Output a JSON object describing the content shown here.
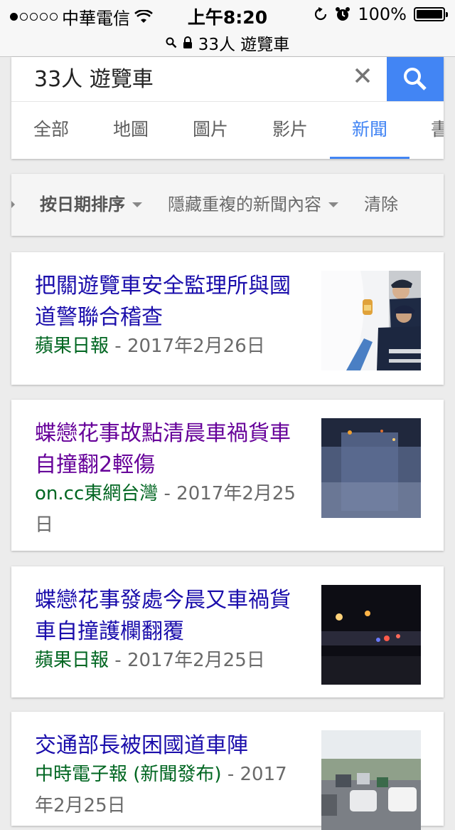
{
  "status_bar": {
    "carrier": "中華電信",
    "time": "上午8:20",
    "battery": "100%"
  },
  "url_bar": {
    "text": "33人 遊覽車"
  },
  "search": {
    "query": "33人 遊覽車",
    "accent_color": "#4285f4",
    "tabs": [
      {
        "label": "全部",
        "active": false
      },
      {
        "label": "地圖",
        "active": false
      },
      {
        "label": "圖片",
        "active": false
      },
      {
        "label": "影片",
        "active": false
      },
      {
        "label": "新聞",
        "active": true
      },
      {
        "label": "書",
        "active": false
      }
    ]
  },
  "filters": {
    "sort": "按日期排序",
    "dedupe": "隱藏重複的新聞內容",
    "clear": "清除"
  },
  "results": [
    {
      "title": "把關遊覽車安全監理所與國道警聯合稽查",
      "source": "蘋果日報",
      "separator": " - ",
      "date": "2017年2月26日",
      "visited": false,
      "thumbnail": "police-inspecting-bus-photo"
    },
    {
      "title": "蝶戀花事故點清晨車禍貨車自撞翻2輕傷",
      "source": "on.cc東網台灣",
      "separator": " - ",
      "date": "2017年2月25日",
      "visited": true,
      "thumbnail": "night-highway-blurry-photo"
    },
    {
      "title": "蝶戀花事發處今晨又車禍貨車自撞護欄翻覆",
      "source": "蘋果日報",
      "separator": " - ",
      "date": "2017年2月25日",
      "visited": false,
      "thumbnail": "night-accident-scene-photo"
    },
    {
      "title": "交通部長被困國道車陣",
      "source": "中時電子報 (新聞發布)",
      "separator": " - ",
      "date": "2017年2月25日",
      "visited": false,
      "thumbnail": "highway-traffic-jam-photo"
    }
  ]
}
